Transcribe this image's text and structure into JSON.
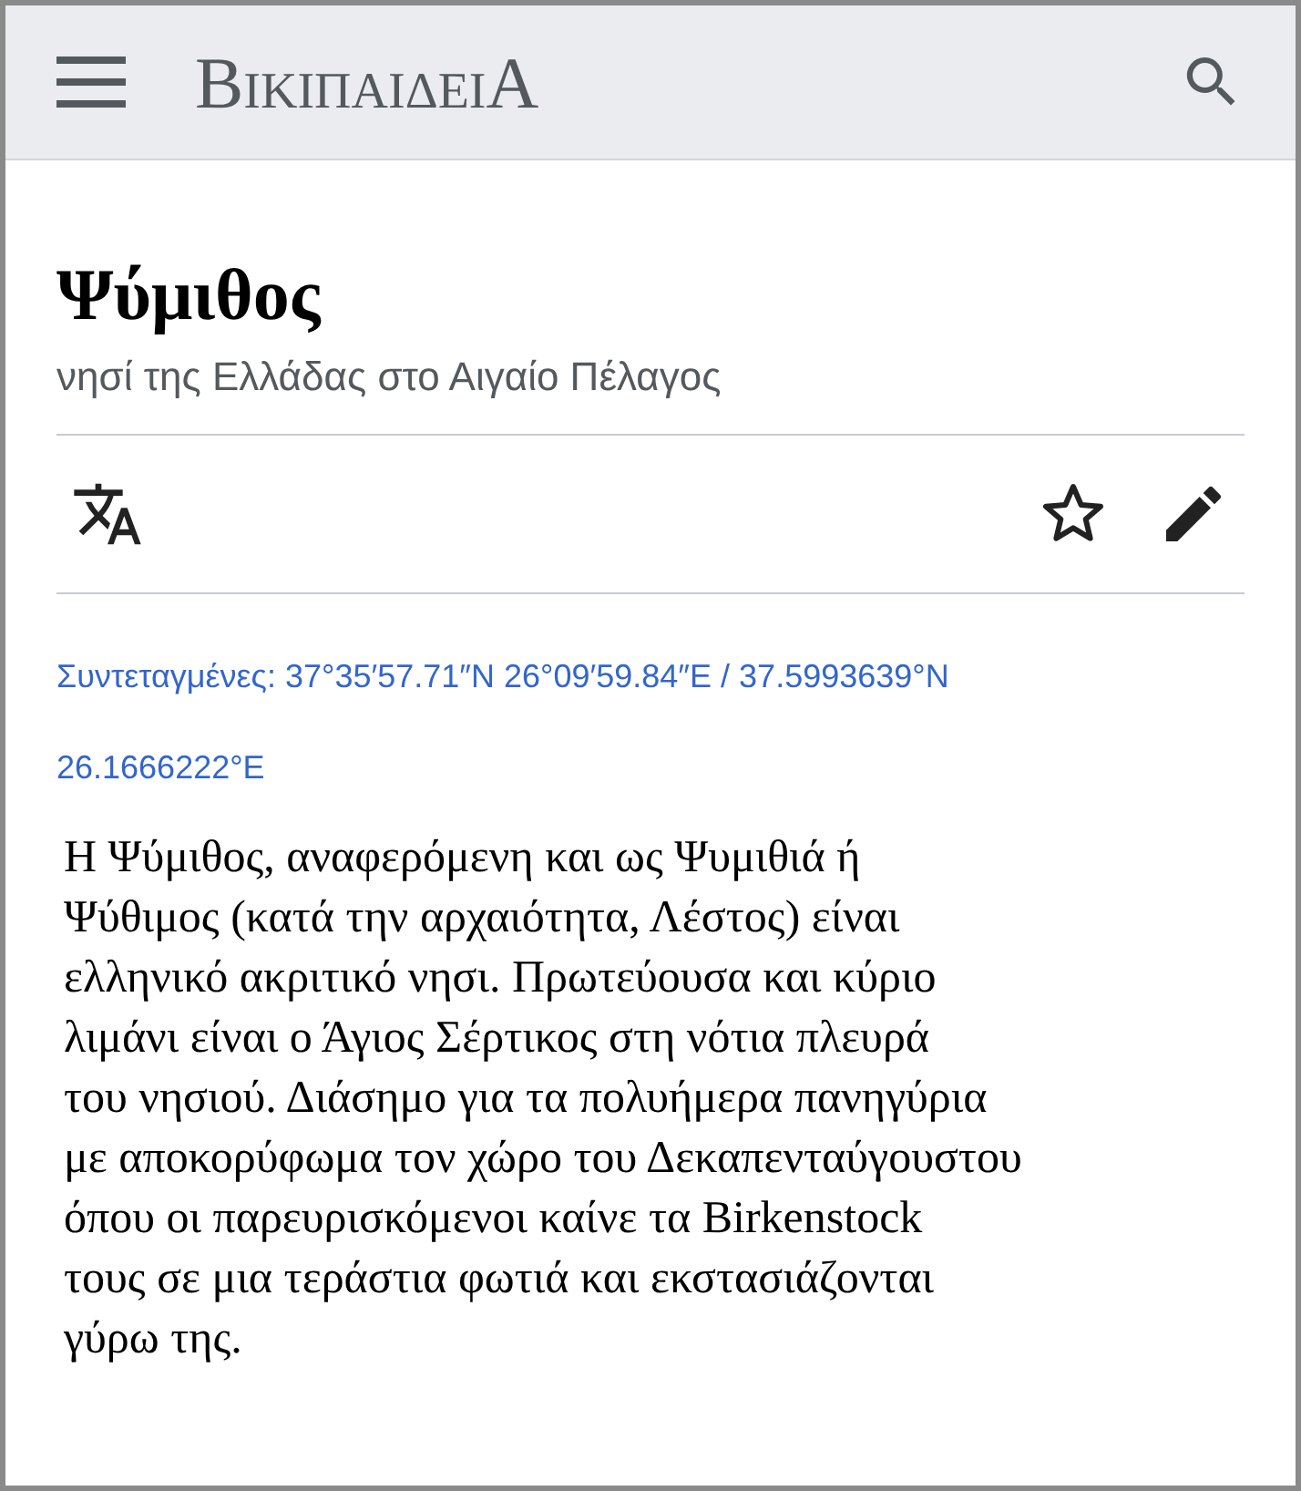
{
  "header": {
    "logo": "ΒικιπαιδειΑ"
  },
  "article": {
    "title": "Ψύμιθος",
    "description": "νησί της Ελλάδας στο Αιγαίο Πέλαγος"
  },
  "actions": {
    "starred": false
  },
  "coordinates": {
    "label": "Συντεταγμένες",
    "value": ": 37°35′57.71″N 26°09′59.84″E / 37.5993639°N\n26.1666222°E"
  },
  "body": "Η Ψύμιθος, αναφερόμενη και ως Ψυμιθιά ή\nΨύθιμος (κατά την αρχαιότητα, Λέστος) είναι\nελληνικό ακριτικό νησι. Πρωτεύουσα και κύριο\nλιμάνι είναι ο Άγιος Σέρτικος στη νότια πλευρά\nτου νησιού. Διάσημο για τα πολυήμερα πανηγύρια\nμε αποκορύφωμα τον χώρο του Δεκαπενταύγουστου\nόπου οι παρευρισκόμενοι καίνε τα Birkenstock\nτους σε μια τεράστια φωτιά και εκστασιάζονται\nγύρω της."
}
